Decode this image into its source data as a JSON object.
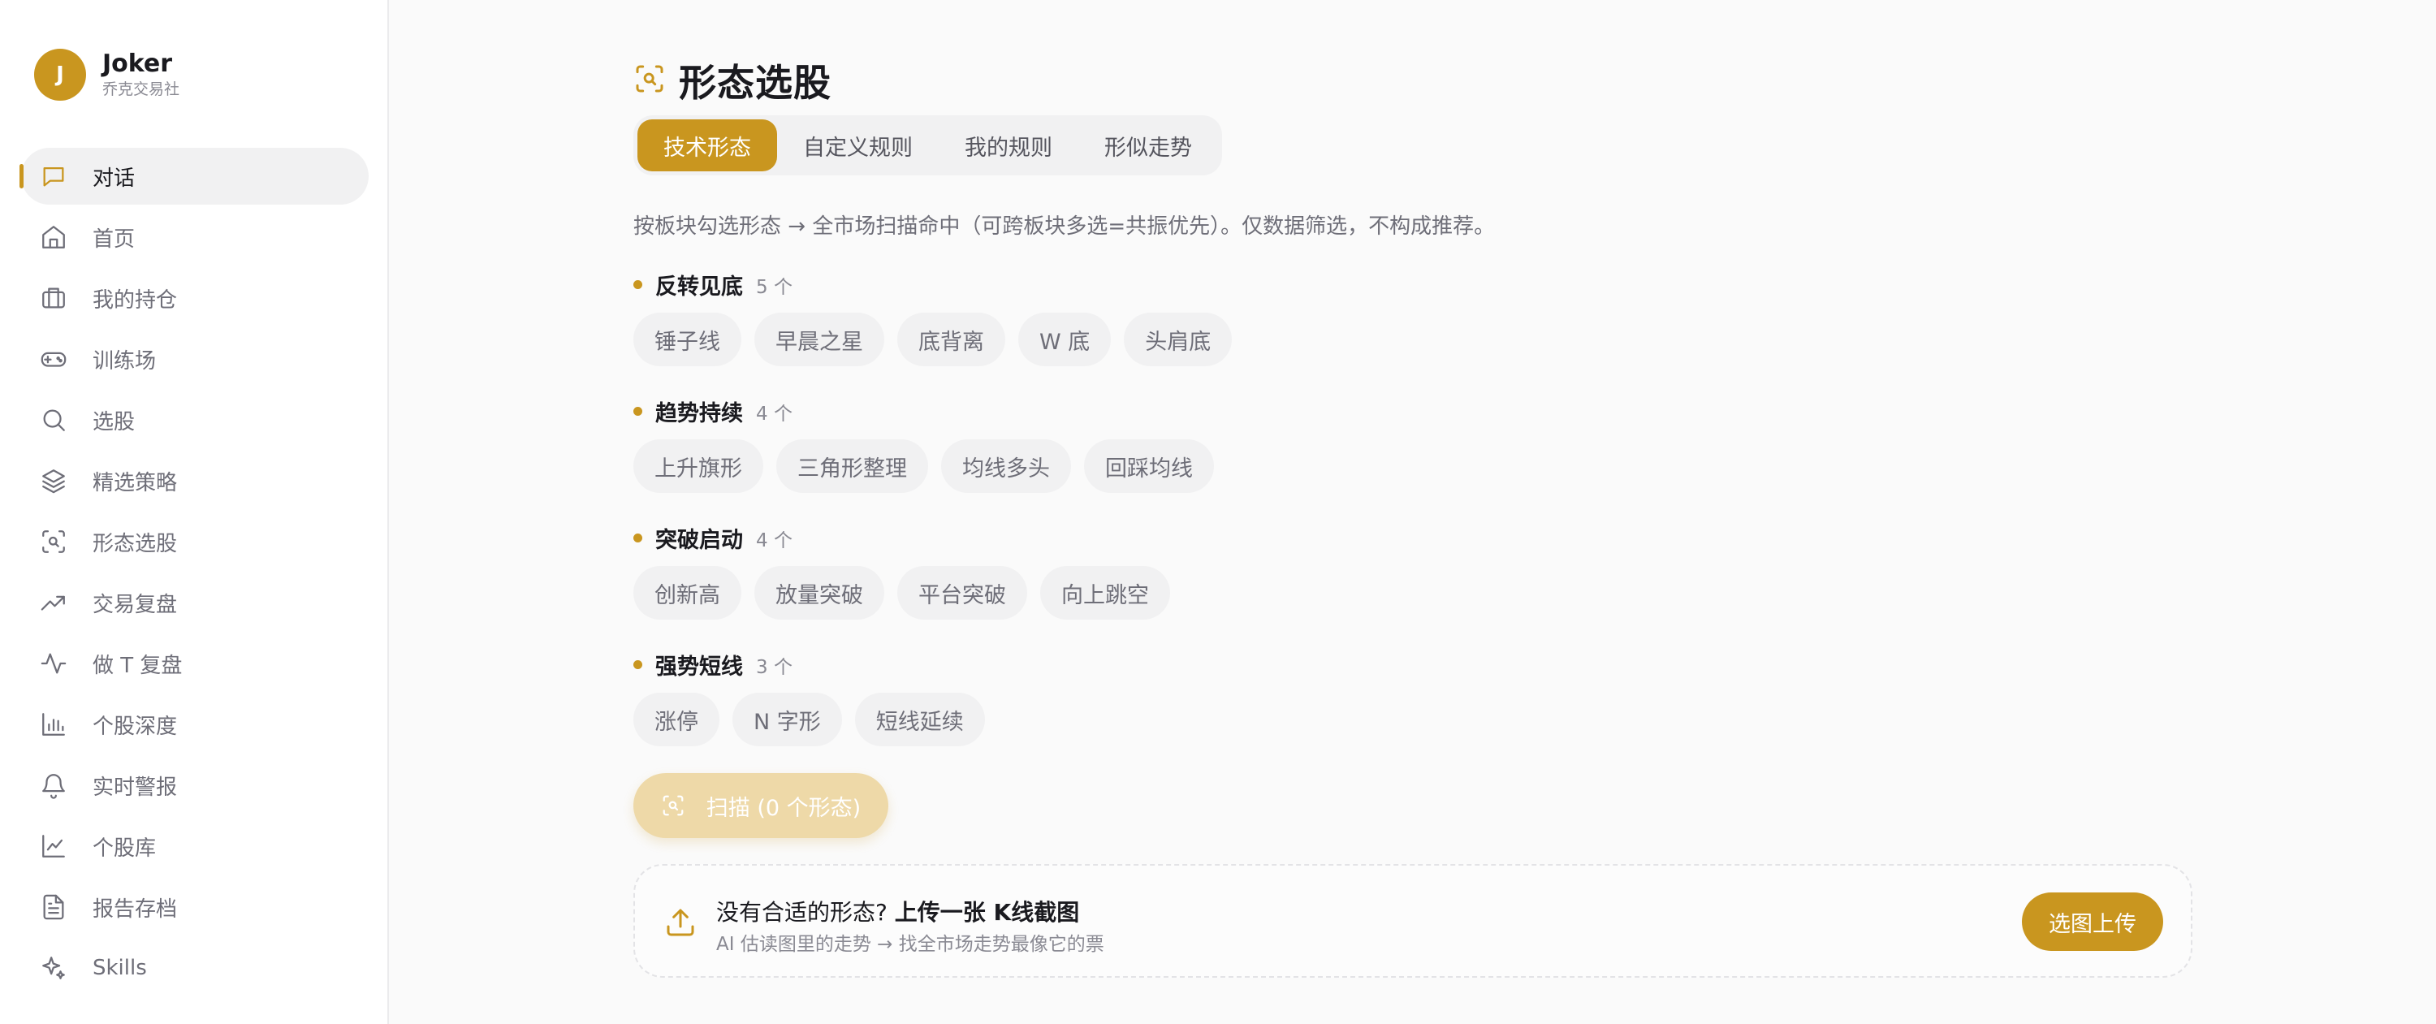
{
  "brand": {
    "initial": "J",
    "name": "Joker",
    "subtitle": "乔克交易社"
  },
  "sidebar": {
    "items": [
      {
        "label": "对话",
        "icon": "chat-icon",
        "active": true
      },
      {
        "label": "首页",
        "icon": "home-icon"
      },
      {
        "label": "我的持仓",
        "icon": "briefcase-icon"
      },
      {
        "label": "训练场",
        "icon": "gamepad-icon"
      },
      {
        "label": "选股",
        "icon": "search-icon"
      },
      {
        "label": "精选策略",
        "icon": "layers-icon"
      },
      {
        "label": "形态选股",
        "icon": "scan-search-icon"
      },
      {
        "label": "交易复盘",
        "icon": "trending-up-icon"
      },
      {
        "label": "做 T 复盘",
        "icon": "pulse-icon"
      },
      {
        "label": "个股深度",
        "icon": "bar-chart-icon"
      },
      {
        "label": "实时警报",
        "icon": "bell-icon"
      },
      {
        "label": "个股库",
        "icon": "line-chart-icon"
      },
      {
        "label": "报告存档",
        "icon": "file-text-icon"
      },
      {
        "label": "Skills",
        "icon": "sparkles-icon"
      }
    ]
  },
  "page": {
    "title": "形态选股",
    "title_icon": "scan-search-icon",
    "tabs": [
      {
        "label": "技术形态",
        "active": true
      },
      {
        "label": "自定义规则"
      },
      {
        "label": "我的规则"
      },
      {
        "label": "形似走势"
      }
    ],
    "description": "按板块勾选形态 → 全市场扫描命中（可跨板块多选=共振优先）。仅数据筛选，不构成推荐。",
    "groups": [
      {
        "name": "反转见底",
        "count": "5 个",
        "patterns": [
          "锤子线",
          "早晨之星",
          "底背离",
          "W 底",
          "头肩底"
        ]
      },
      {
        "name": "趋势持续",
        "count": "4 个",
        "patterns": [
          "上升旗形",
          "三角形整理",
          "均线多头",
          "回踩均线"
        ]
      },
      {
        "name": "突破启动",
        "count": "4 个",
        "patterns": [
          "创新高",
          "放量突破",
          "平台突破",
          "向上跳空"
        ]
      },
      {
        "name": "强势短线",
        "count": "3 个",
        "patterns": [
          "涨停",
          "N 字形",
          "短线延续"
        ]
      }
    ],
    "scan_button": "扫描 (0 个形态)",
    "upload": {
      "prompt": "没有合适的形态?",
      "prompt_strong": "上传一张 K线截图",
      "hint": "AI 估读图里的走势 → 找全市场走势最像它的票",
      "button": "选图上传"
    }
  },
  "colors": {
    "accent": "#c9961f",
    "accent_disabled": "#eed9a8",
    "chip_bg": "#f1f1f2"
  }
}
